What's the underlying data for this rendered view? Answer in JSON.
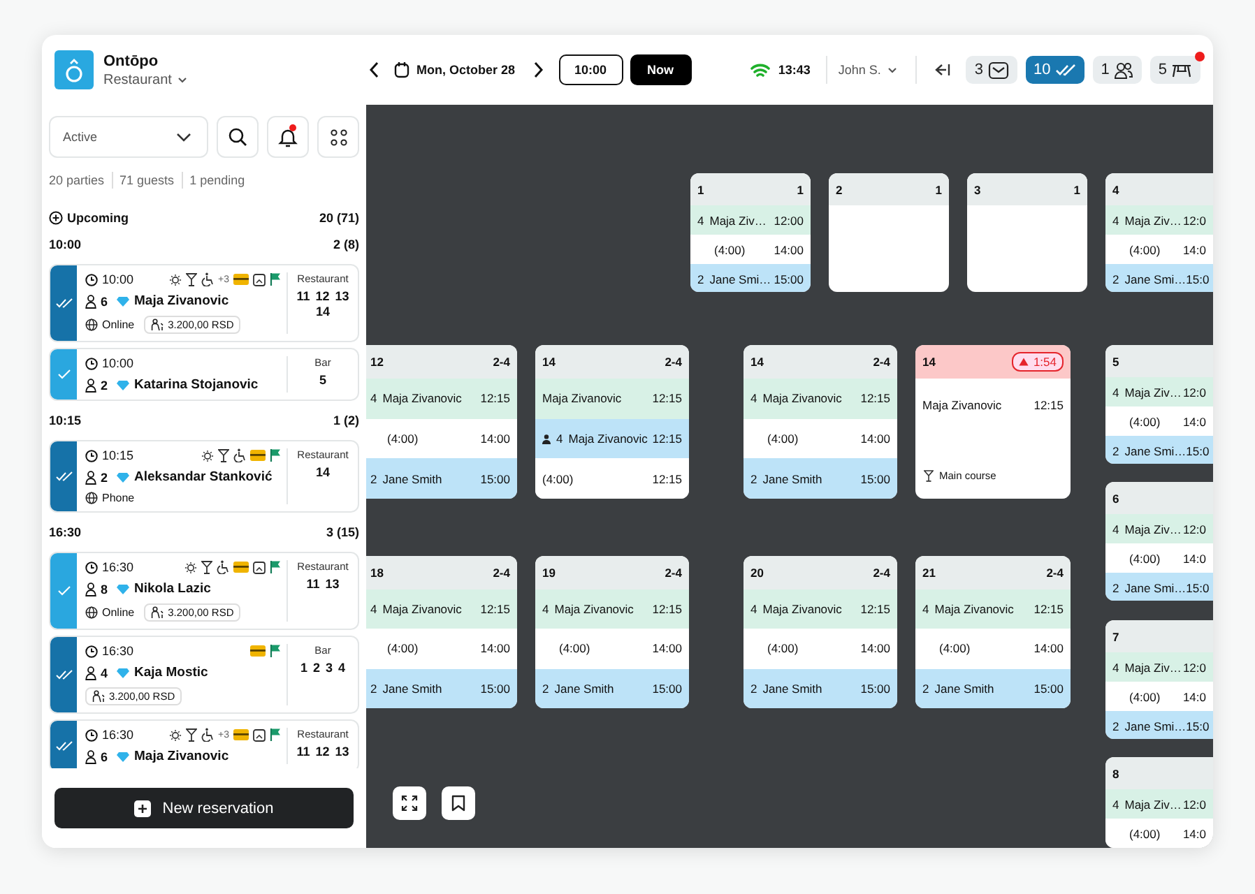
{
  "brand": {
    "name": "Ontōpo",
    "venue": "Restaurant"
  },
  "date_nav": {
    "date": "Mon, October 28",
    "time": "10:00",
    "now": "Now"
  },
  "status": {
    "clock": "13:43",
    "user": "John S."
  },
  "counters": [
    {
      "count": "3",
      "kind": "mail",
      "selected": false,
      "alert": false
    },
    {
      "count": "10",
      "kind": "checks",
      "selected": true,
      "alert": false
    },
    {
      "count": "1",
      "kind": "guests",
      "selected": false,
      "alert": false
    },
    {
      "count": "5",
      "kind": "table",
      "selected": false,
      "alert": true
    }
  ],
  "sidebar": {
    "filter": "Active",
    "notifications_alert": true,
    "stats": [
      "20 parties",
      "71 guests",
      "1 pending"
    ],
    "section": {
      "label": "Upcoming",
      "count": "20 (71)"
    },
    "groups": [
      {
        "time": "10:00",
        "count": "2 (8)",
        "reservations": [
          {
            "seated": true,
            "time": "10:00",
            "amenities": [
              {
                "kind": "sun"
              },
              {
                "kind": "cocktail"
              },
              {
                "kind": "wheelchair"
              },
              {
                "kind": "more",
                "label": "+3"
              },
              {
                "kind": "card"
              },
              {
                "kind": "doc"
              },
              {
                "kind": "flag"
              }
            ],
            "guests": "6",
            "vip": true,
            "name": "Maja Zivanovic",
            "source": "Online",
            "deposit": "3.200,00 RSD",
            "area": "Restaurant",
            "tables": [
              "11",
              "12",
              "13",
              "14"
            ]
          },
          {
            "seated": false,
            "time": "10:00",
            "guests": "2",
            "vip": true,
            "name": "Katarina Stojanovic",
            "area": "Bar",
            "tables": [
              "5"
            ]
          }
        ]
      },
      {
        "time": "10:15",
        "count": "1 (2)",
        "reservations": [
          {
            "seated": true,
            "time": "10:15",
            "amenities": [
              {
                "kind": "sun"
              },
              {
                "kind": "cocktail"
              },
              {
                "kind": "wheelchair"
              },
              {
                "kind": "card"
              },
              {
                "kind": "flag"
              }
            ],
            "guests": "2",
            "vip": true,
            "name": "Aleksandar Stanković",
            "source": "Phone",
            "area": "Restaurant",
            "tables": [
              "14"
            ]
          }
        ]
      },
      {
        "time": "16:30",
        "count": "3 (15)",
        "reservations": [
          {
            "seated": false,
            "time": "16:30",
            "amenities": [
              {
                "kind": "sun"
              },
              {
                "kind": "cocktail"
              },
              {
                "kind": "wheelchair"
              },
              {
                "kind": "card"
              },
              {
                "kind": "doc"
              },
              {
                "kind": "flag"
              }
            ],
            "guests": "8",
            "vip": true,
            "name": "Nikola Lazic",
            "source": "Online",
            "deposit": "3.200,00 RSD",
            "area": "Restaurant",
            "tables": [
              "11",
              "13"
            ]
          },
          {
            "seated": true,
            "time": "16:30",
            "amenities": [
              {
                "kind": "card"
              },
              {
                "kind": "flag"
              }
            ],
            "guests": "4",
            "vip": true,
            "name": "Kaja Mostic",
            "deposit": "3.200,00 RSD",
            "area": "Bar",
            "tables": [
              "1",
              "2",
              "3",
              "4"
            ]
          },
          {
            "seated": true,
            "time": "16:30",
            "amenities": [
              {
                "kind": "sun"
              },
              {
                "kind": "cocktail"
              },
              {
                "kind": "wheelchair"
              },
              {
                "kind": "more",
                "label": "+3"
              },
              {
                "kind": "card"
              },
              {
                "kind": "doc"
              },
              {
                "kind": "flag"
              }
            ],
            "guests": "6",
            "vip": true,
            "name": "Maja Zivanovic",
            "area": "Restaurant",
            "tables": [
              "11",
              "12",
              "13"
            ]
          }
        ]
      }
    ],
    "new_button": "New reservation"
  },
  "floor": {
    "tables": [
      {
        "number": "1",
        "capacity": "1",
        "rows": [
          {
            "kind": "current",
            "guests": "4",
            "name": "Maja Ziv…",
            "time": "12:00"
          },
          {
            "kind": "duration",
            "name": "(4:00)",
            "time": "14:00"
          },
          {
            "kind": "next",
            "guests": "2",
            "name": "Jane Smi…",
            "time": "15:00"
          }
        ]
      },
      {
        "number": "2",
        "capacity": "1"
      },
      {
        "number": "3",
        "capacity": "1"
      },
      {
        "number": "4",
        "rows": [
          {
            "kind": "current",
            "guests": "4",
            "name": "Maja Ziv…",
            "time": "12:0"
          },
          {
            "kind": "duration",
            "name": "(4:00)",
            "time": "14:0"
          },
          {
            "kind": "next",
            "guests": "2",
            "name": "Jane Smi…",
            "time": "15:0"
          }
        ]
      },
      {
        "number": "12",
        "capacity": "2-4",
        "rows": [
          {
            "kind": "current",
            "guests": "4",
            "name": "Maja Zivanovic",
            "time": "12:15"
          },
          {
            "kind": "duration",
            "name": "(4:00)",
            "time": "14:00"
          },
          {
            "kind": "next",
            "guests": "2",
            "name": "Jane Smith",
            "time": "15:00"
          }
        ]
      },
      {
        "number": "14",
        "capacity": "2-4",
        "rows": [
          {
            "kind": "current",
            "name": "Maja Zivanovic",
            "time": "12:15"
          },
          {
            "kind": "next",
            "marked": true,
            "guests": "4",
            "name": "Maja Zivanovic",
            "time": "12:15"
          },
          {
            "kind": "plain",
            "name": "(4:00)",
            "time": "12:15"
          }
        ]
      },
      {
        "number": "14",
        "capacity": "2-4",
        "rows": [
          {
            "kind": "current",
            "guests": "4",
            "name": "Maja Zivanovic",
            "time": "12:15"
          },
          {
            "kind": "duration",
            "name": "(4:00)",
            "time": "14:00"
          },
          {
            "kind": "next",
            "guests": "2",
            "name": "Jane Smith",
            "time": "15:00"
          }
        ]
      },
      {
        "number": "14",
        "timer": "1:54",
        "rows": [
          {
            "kind": "plain",
            "name": "Maja Zivanovic",
            "time": "12:15"
          }
        ],
        "note": "Main course"
      },
      {
        "number": "5",
        "rows": [
          {
            "kind": "current",
            "guests": "4",
            "name": "Maja Ziv…",
            "time": "12:0"
          },
          {
            "kind": "duration",
            "name": "(4:00)",
            "time": "14:0"
          },
          {
            "kind": "next",
            "guests": "2",
            "name": "Jane Smi…",
            "time": "15:0"
          }
        ]
      },
      {
        "number": "6",
        "rows": [
          {
            "kind": "current",
            "guests": "4",
            "name": "Maja Ziv…",
            "time": "12:0"
          },
          {
            "kind": "duration",
            "name": "(4:00)",
            "time": "14:0"
          },
          {
            "kind": "next",
            "guests": "2",
            "name": "Jane Smi…",
            "time": "15:0"
          }
        ]
      },
      {
        "number": "18",
        "capacity": "2-4",
        "rows": [
          {
            "kind": "current",
            "guests": "4",
            "name": "Maja Zivanovic",
            "time": "12:15"
          },
          {
            "kind": "duration",
            "name": "(4:00)",
            "time": "14:00"
          },
          {
            "kind": "next",
            "guests": "2",
            "name": "Jane Smith",
            "time": "15:00"
          }
        ]
      },
      {
        "number": "19",
        "capacity": "2-4",
        "rows": [
          {
            "kind": "current",
            "guests": "4",
            "name": "Maja Zivanovic",
            "time": "12:15"
          },
          {
            "kind": "duration",
            "name": "(4:00)",
            "time": "14:00"
          },
          {
            "kind": "next",
            "guests": "2",
            "name": "Jane Smith",
            "time": "15:00"
          }
        ]
      },
      {
        "number": "20",
        "capacity": "2-4",
        "rows": [
          {
            "kind": "current",
            "guests": "4",
            "name": "Maja Zivanovic",
            "time": "12:15"
          },
          {
            "kind": "duration",
            "name": "(4:00)",
            "time": "14:00"
          },
          {
            "kind": "next",
            "guests": "2",
            "name": "Jane Smith",
            "time": "15:00"
          }
        ]
      },
      {
        "number": "21",
        "capacity": "2-4",
        "rows": [
          {
            "kind": "current",
            "guests": "4",
            "name": "Maja Zivanovic",
            "time": "12:15"
          },
          {
            "kind": "duration",
            "name": "(4:00)",
            "time": "14:00"
          },
          {
            "kind": "next",
            "guests": "2",
            "name": "Jane Smith",
            "time": "15:00"
          }
        ]
      },
      {
        "number": "7",
        "rows": [
          {
            "kind": "current",
            "guests": "4",
            "name": "Maja Ziv…",
            "time": "12:0"
          },
          {
            "kind": "duration",
            "name": "(4:00)",
            "time": "14:0"
          },
          {
            "kind": "next",
            "guests": "2",
            "name": "Jane Smi…",
            "time": "15:0"
          }
        ]
      },
      {
        "number": "8",
        "rows": [
          {
            "kind": "current",
            "guests": "4",
            "name": "Maja Ziv…",
            "time": "12:0"
          },
          {
            "kind": "duration",
            "name": "(4:00)",
            "time": "14:0"
          }
        ]
      }
    ]
  }
}
